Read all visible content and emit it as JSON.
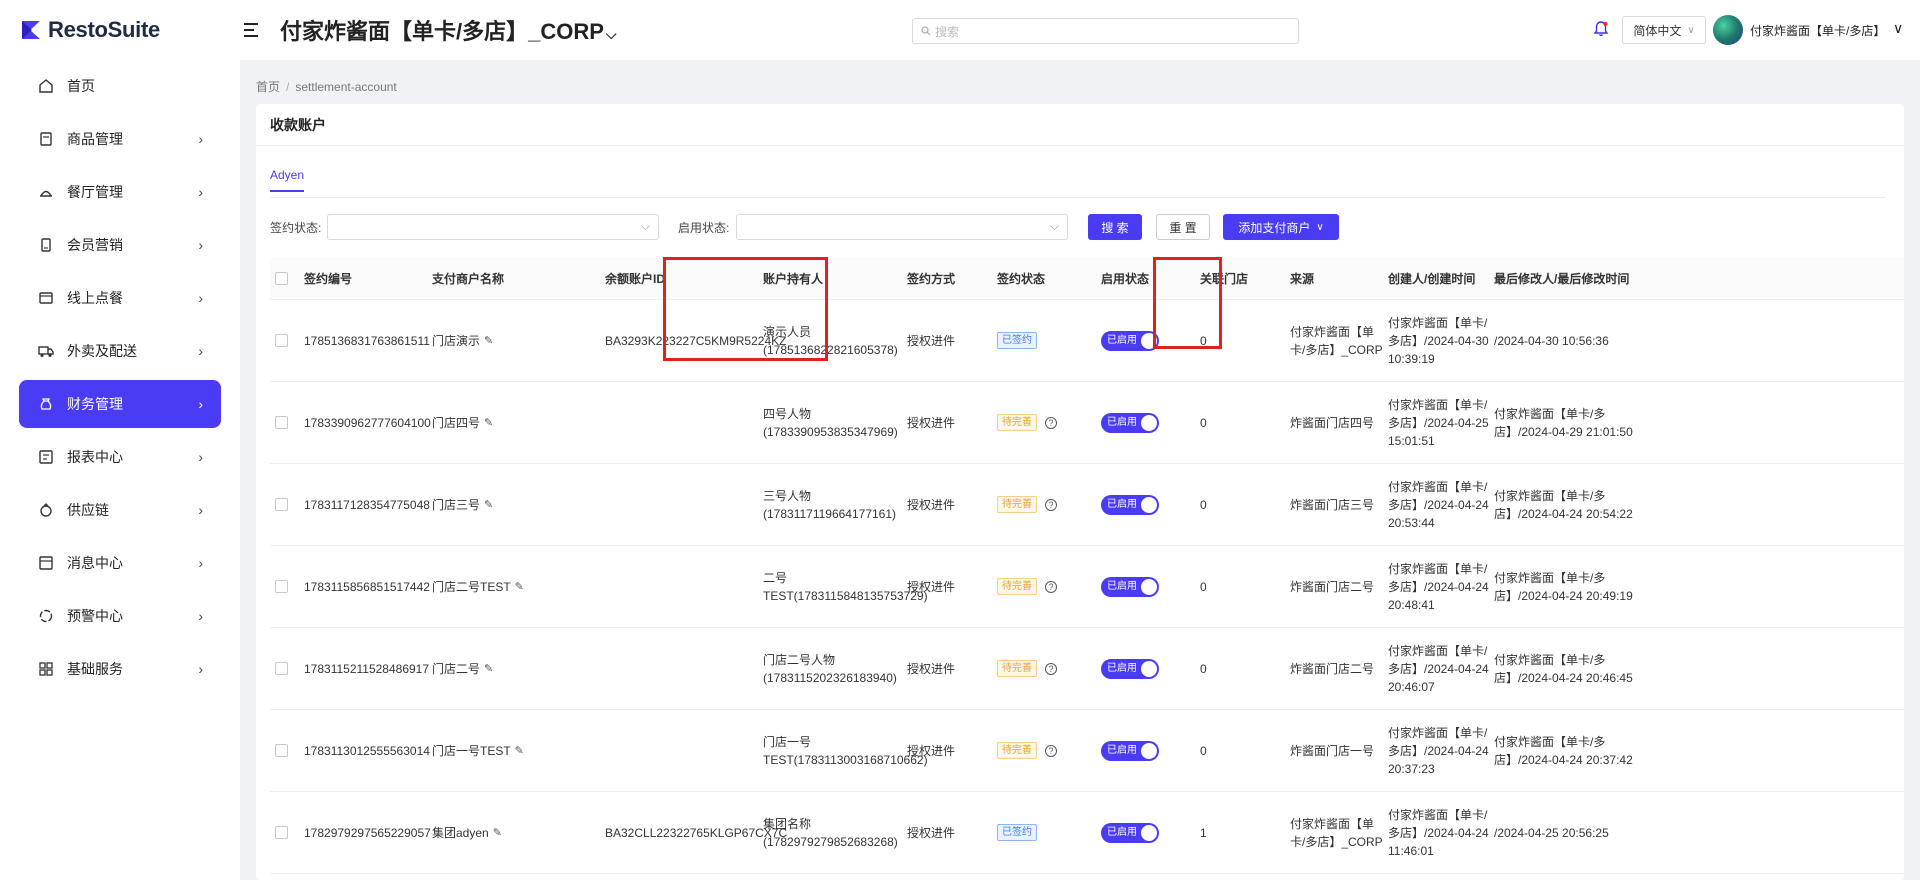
{
  "app": {
    "logo_text": "RestoSuite"
  },
  "sidebar": {
    "items": [
      {
        "label": "首页",
        "icon": "home-icon",
        "has_children": false
      },
      {
        "label": "商品管理",
        "icon": "product-icon",
        "has_children": true
      },
      {
        "label": "餐厅管理",
        "icon": "restaurant-icon",
        "has_children": true
      },
      {
        "label": "会员营销",
        "icon": "member-icon",
        "has_children": true
      },
      {
        "label": "线上点餐",
        "icon": "online-order-icon",
        "has_children": true
      },
      {
        "label": "外卖及配送",
        "icon": "delivery-icon",
        "has_children": true
      },
      {
        "label": "财务管理",
        "icon": "finance-icon",
        "has_children": true,
        "active": true
      },
      {
        "label": "报表中心",
        "icon": "report-icon",
        "has_children": true
      },
      {
        "label": "供应链",
        "icon": "supply-chain-icon",
        "has_children": true
      },
      {
        "label": "消息中心",
        "icon": "message-icon",
        "has_children": true
      },
      {
        "label": "预警中心",
        "icon": "alert-icon",
        "has_children": true
      },
      {
        "label": "基础服务",
        "icon": "grid-icon",
        "has_children": true
      }
    ]
  },
  "header": {
    "title": "付家炸酱面【单卡/多店】_CORP",
    "search_placeholder": "搜索",
    "language": "简体中文",
    "user_name": "付家炸酱面【单卡/多店】"
  },
  "breadcrumb": {
    "home": "首页",
    "current": "settlement-account"
  },
  "page": {
    "title": "收款账户",
    "tab": "Adyen",
    "filters": {
      "sign_status_label": "签约状态:",
      "enable_status_label": "启用状态:",
      "search_button": "搜 索",
      "reset_button": "重 置",
      "add_button": "添加支付商户"
    }
  },
  "table": {
    "columns": [
      "签约编号",
      "支付商户名称",
      "余额账户ID",
      "账户持有人",
      "签约方式",
      "签约状态",
      "启用状态",
      "关联门店",
      "来源",
      "创建人/创建时间",
      "最后修改人/最后修改时间"
    ],
    "rows": [
      {
        "id": "1785136831763861511",
        "merchant": "门店演示",
        "balance_id": "BA3293K223227C5KM9R5224KZ",
        "holder_l1": "演示人员",
        "holder_l2": "(1785136822821605378)",
        "method": "授权进件",
        "sign_status": "已签约",
        "sign_type": "signed",
        "enabled": "已启用",
        "stores": "0",
        "source_l1": "付家炸酱面【单",
        "source_l2": "卡/多店】_CORP",
        "created_l1": "付家炸酱面【单卡/",
        "created_l2": "多店】/2024-04-30",
        "created_l3": "10:39:19",
        "modified_l1": "/2024-04-30 10:56:36",
        "modified_l2": ""
      },
      {
        "id": "1783390962777604100",
        "merchant": "门店四号",
        "balance_id": "",
        "holder_l1": "四号人物",
        "holder_l2": "(1783390953835347969)",
        "method": "授权进件",
        "sign_status": "待完善",
        "sign_type": "pending",
        "enabled": "已启用",
        "stores": "0",
        "source_l1": "炸酱面门店四号",
        "source_l2": "",
        "created_l1": "付家炸酱面【单卡/",
        "created_l2": "多店】/2024-04-25",
        "created_l3": "15:01:51",
        "modified_l1": "付家炸酱面【单卡/多",
        "modified_l2": "店】/2024-04-29 21:01:50"
      },
      {
        "id": "1783117128354775048",
        "merchant": "门店三号",
        "balance_id": "",
        "holder_l1": "三号人物",
        "holder_l2": "(1783117119664177161)",
        "method": "授权进件",
        "sign_status": "待完善",
        "sign_type": "pending",
        "enabled": "已启用",
        "stores": "0",
        "source_l1": "炸酱面门店三号",
        "source_l2": "",
        "created_l1": "付家炸酱面【单卡/",
        "created_l2": "多店】/2024-04-24",
        "created_l3": "20:53:44",
        "modified_l1": "付家炸酱面【单卡/多",
        "modified_l2": "店】/2024-04-24 20:54:22"
      },
      {
        "id": "1783115856851517442",
        "merchant": "门店二号TEST",
        "balance_id": "",
        "holder_l1": "二号",
        "holder_l2": "TEST(1783115848135753729)",
        "method": "授权进件",
        "sign_status": "待完善",
        "sign_type": "pending",
        "enabled": "已启用",
        "stores": "0",
        "source_l1": "炸酱面门店二号",
        "source_l2": "",
        "created_l1": "付家炸酱面【单卡/",
        "created_l2": "多店】/2024-04-24",
        "created_l3": "20:48:41",
        "modified_l1": "付家炸酱面【单卡/多",
        "modified_l2": "店】/2024-04-24 20:49:19"
      },
      {
        "id": "1783115211528486917",
        "merchant": "门店二号",
        "balance_id": "",
        "holder_l1": "门店二号人物",
        "holder_l2": "(1783115202326183940)",
        "method": "授权进件",
        "sign_status": "待完善",
        "sign_type": "pending",
        "enabled": "已启用",
        "stores": "0",
        "source_l1": "炸酱面门店二号",
        "source_l2": "",
        "created_l1": "付家炸酱面【单卡/",
        "created_l2": "多店】/2024-04-24",
        "created_l3": "20:46:07",
        "modified_l1": "付家炸酱面【单卡/多",
        "modified_l2": "店】/2024-04-24 20:46:45"
      },
      {
        "id": "1783113012555563014",
        "merchant": "门店一号TEST",
        "balance_id": "",
        "holder_l1": "门店一号",
        "holder_l2": "TEST(1783113003168710662)",
        "method": "授权进件",
        "sign_status": "待完善",
        "sign_type": "pending",
        "enabled": "已启用",
        "stores": "0",
        "source_l1": "炸酱面门店一号",
        "source_l2": "",
        "created_l1": "付家炸酱面【单卡/",
        "created_l2": "多店】/2024-04-24",
        "created_l3": "20:37:23",
        "modified_l1": "付家炸酱面【单卡/多",
        "modified_l2": "店】/2024-04-24 20:37:42"
      },
      {
        "id": "1782979297565229057",
        "merchant": "集团adyen",
        "balance_id": "BA32CLL22322765KLGP67CX7C",
        "holder_l1": "集团名称",
        "holder_l2": "(1782979279852683268)",
        "method": "授权进件",
        "sign_status": "已签约",
        "sign_type": "signed",
        "enabled": "已启用",
        "stores": "1",
        "source_l1": "付家炸酱面【单",
        "source_l2": "卡/多店】_CORP",
        "created_l1": "付家炸酱面【单卡/",
        "created_l2": "多店】/2024-04-24",
        "created_l3": "11:46:01",
        "modified_l1": "/2024-04-25 20:56:25",
        "modified_l2": ""
      }
    ]
  },
  "colors": {
    "accent": "#4a3bf5",
    "highlight": "#e0211d",
    "signed": "#3a7ff5",
    "pending": "#e6a23c"
  }
}
